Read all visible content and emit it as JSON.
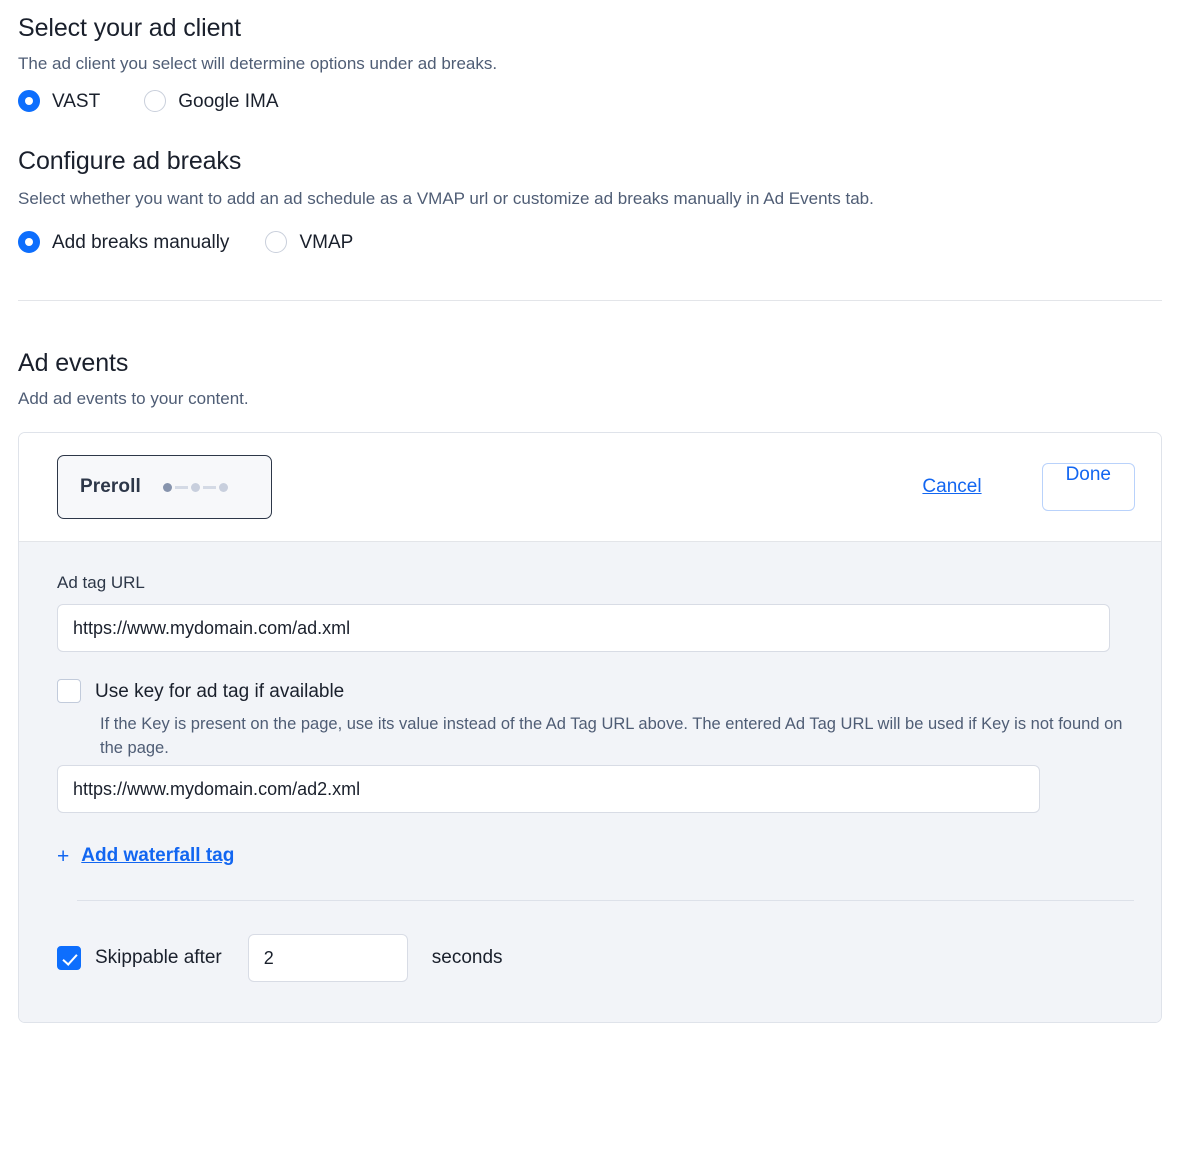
{
  "ad_client": {
    "title": "Select your ad client",
    "description": "The ad client you select will determine options under ad breaks.",
    "options": [
      {
        "label": "VAST",
        "selected": true
      },
      {
        "label": "Google IMA",
        "selected": false
      }
    ]
  },
  "ad_breaks": {
    "title": "Configure ad breaks",
    "description": "Select whether you want to add an ad schedule as a VMAP url or customize ad breaks manually in Ad Events tab.",
    "options": [
      {
        "label": "Add breaks manually",
        "selected": true
      },
      {
        "label": "VMAP",
        "selected": false
      }
    ]
  },
  "ad_events": {
    "title": "Ad events",
    "description": "Add ad events to your content.",
    "card": {
      "chip_label": "Preroll",
      "cancel_label": "Cancel",
      "done_label": "Done",
      "ad_tag_url_label": "Ad tag URL",
      "ad_tag_url_value": "https://www.mydomain.com/ad.xml",
      "use_key_checkbox_label": "Use key for ad tag if available",
      "use_key_checked": false,
      "use_key_help": "If the Key is present on the page, use its value instead of the Ad Tag URL above. The entered Ad Tag URL will be used if Key is not found on the page.",
      "waterfall_url_value": "https://www.mydomain.com/ad2.xml",
      "add_waterfall_plus": "+",
      "add_waterfall_label": "Add waterfall tag",
      "skippable_label": "Skippable after",
      "skippable_checked": true,
      "skippable_seconds": "2",
      "seconds_label": "seconds"
    }
  },
  "colors": {
    "accent_blue": "#0d6efd",
    "link_blue": "#1266f1",
    "body_bg": "#f2f4f8",
    "muted_text": "#4f5d75"
  }
}
